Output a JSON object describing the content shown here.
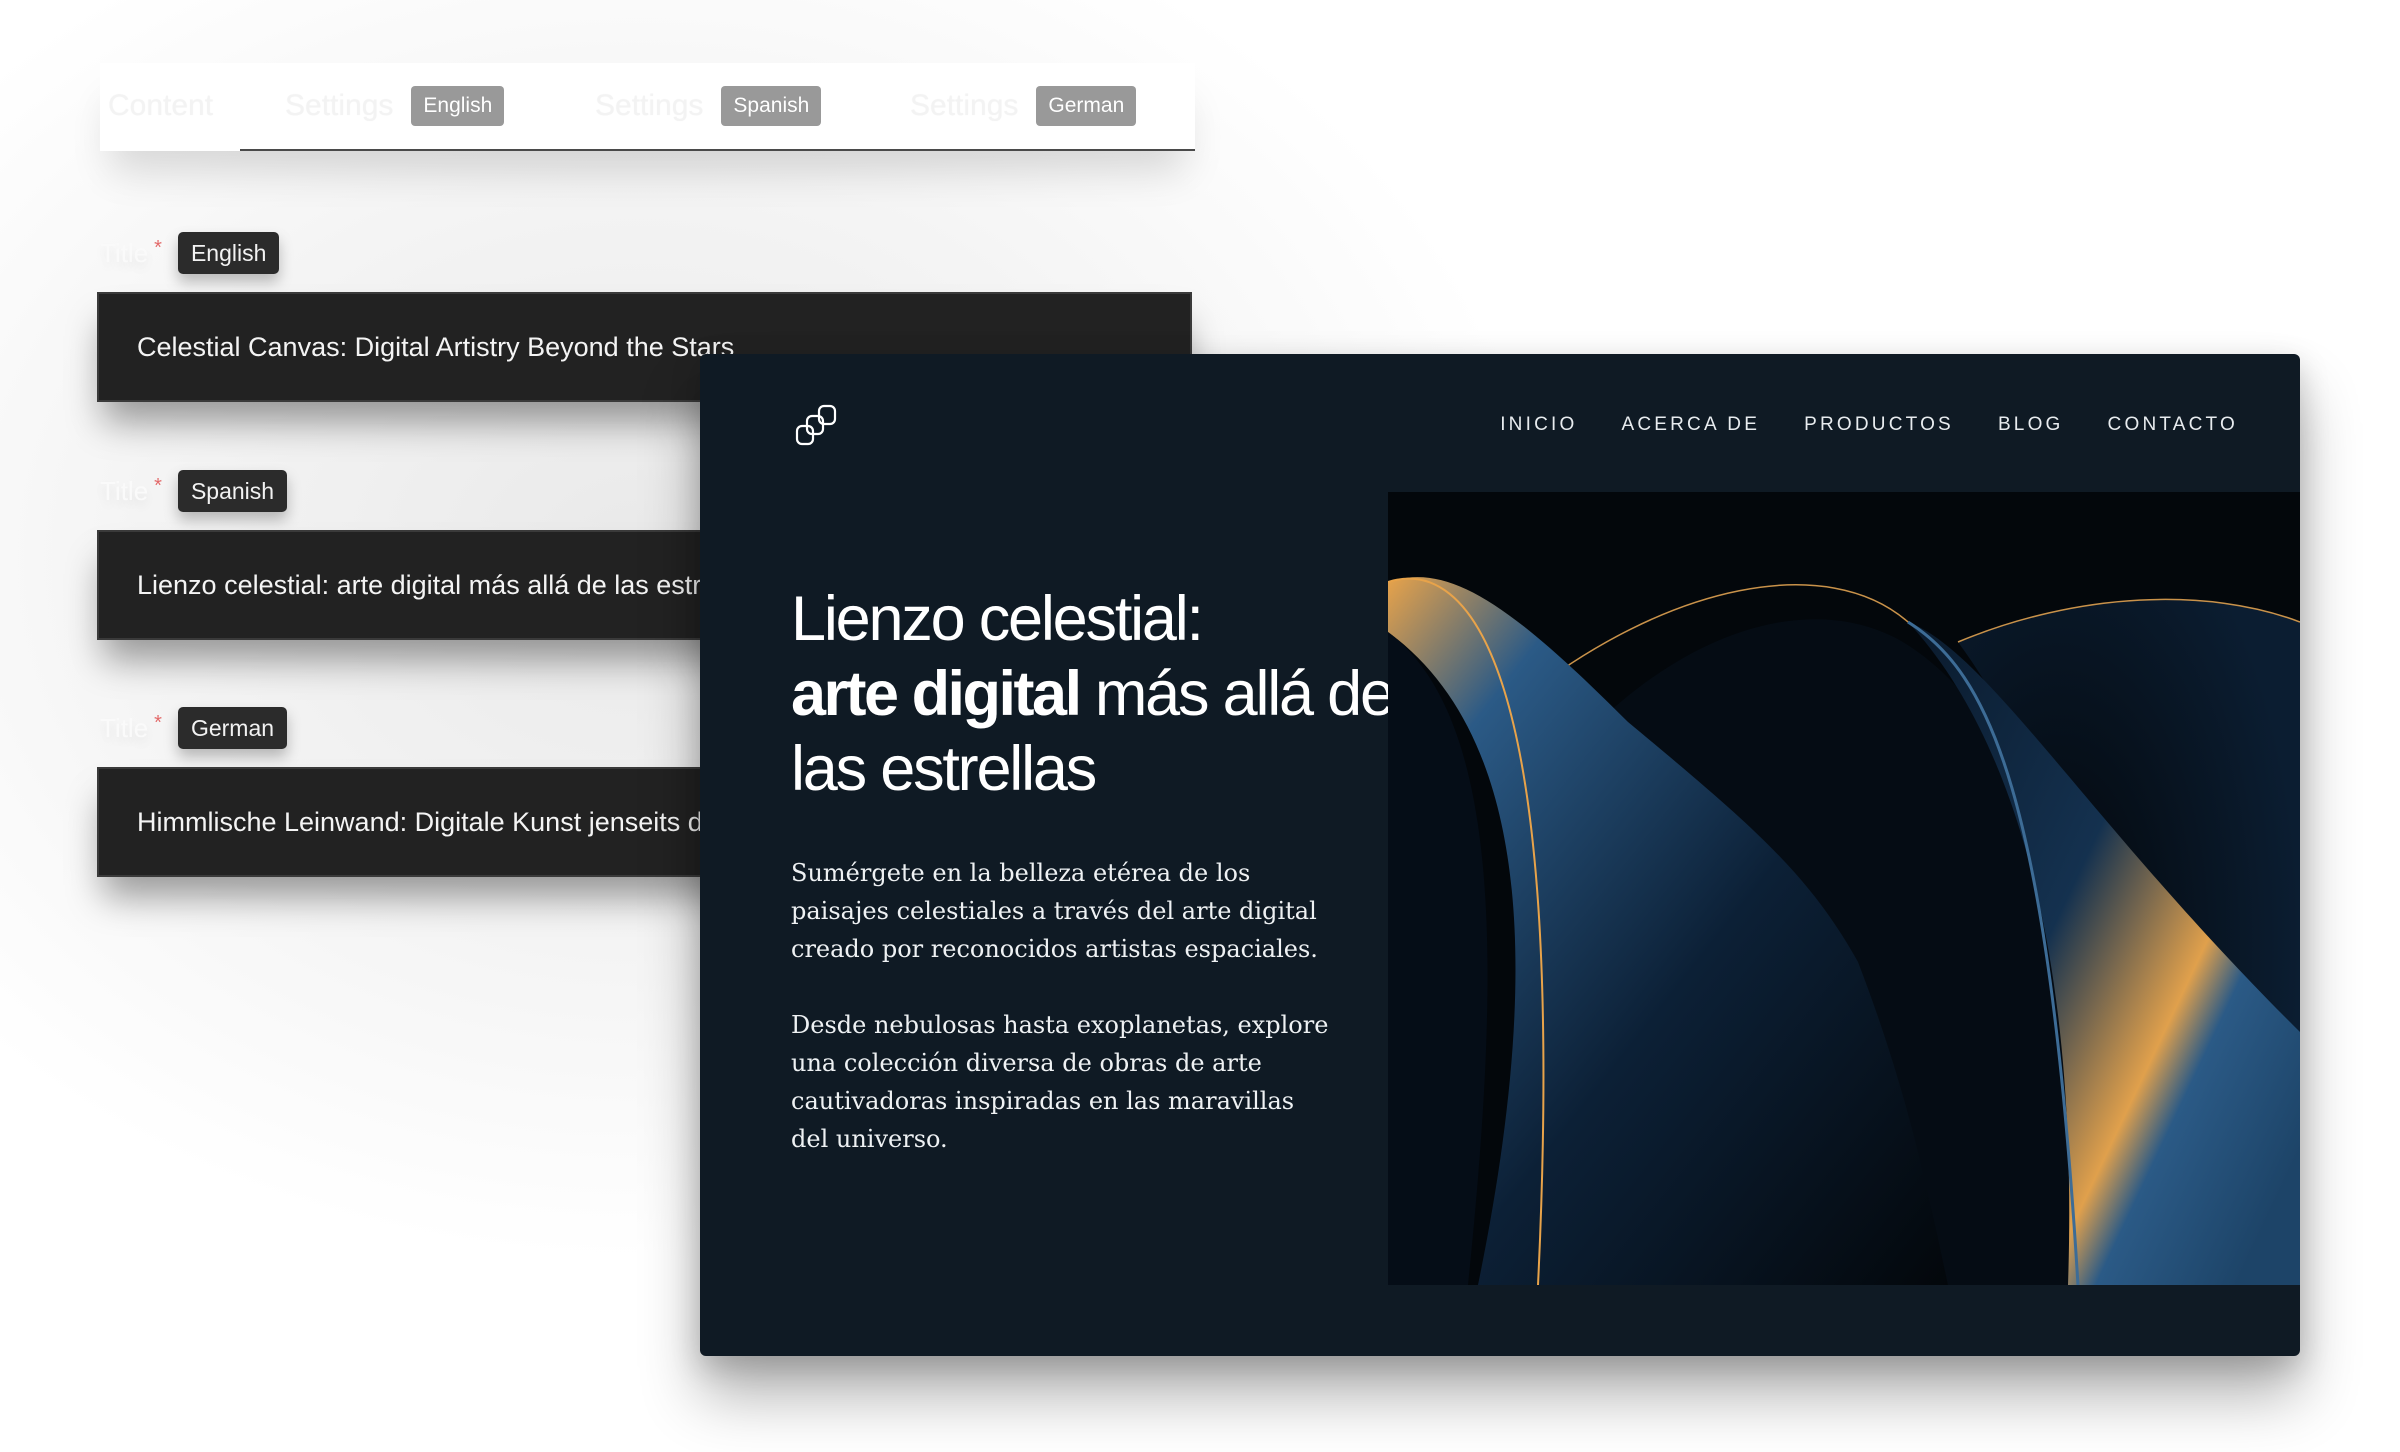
{
  "cms": {
    "tabs": [
      {
        "label": "Content",
        "badge": null,
        "active": true
      },
      {
        "label": "Settings",
        "badge": "English",
        "active": false
      },
      {
        "label": "Settings",
        "badge": "Spanish",
        "active": false
      },
      {
        "label": "Settings",
        "badge": "German",
        "active": false
      }
    ],
    "fields": [
      {
        "label": "Title",
        "required": "*",
        "language": "English",
        "value": "Celestial Canvas: Digital Artistry Beyond the Stars"
      },
      {
        "label": "Title",
        "required": "*",
        "language": "Spanish",
        "value": "Lienzo celestial: arte digital más allá de las estrellas"
      },
      {
        "label": "Title",
        "required": "*",
        "language": "German",
        "value": "Himmlische Leinwand: Digitale Kunst jenseits der Sterne"
      }
    ]
  },
  "site": {
    "logo_icon": "linked-squares-logo",
    "nav": [
      "INICIO",
      "ACERCA DE",
      "PRODUCTOS",
      "BLOG",
      "CONTACTO"
    ],
    "hero": {
      "title_line1": "Lienzo celestial:",
      "title_bold": "arte digital",
      "title_rest": " más allá de las estrellas",
      "paragraphs": [
        "Sumérgete en la belleza etérea de los paisajes celestiales a través del arte digital creado por reconocidos artistas espaciales.",
        "Desde nebulosas hasta exoplanetas, explore una colección diversa de obras de arte cautivadoras inspiradas en las maravillas del universo."
      ],
      "image_description": "abstract dark blue flowing shapes with orange rim light"
    },
    "colors": {
      "panel_bg": "#0f1a24",
      "image_bg": "#03070b",
      "accent_orange": "#e8a34a",
      "accent_blue": "#2b5a86"
    }
  }
}
